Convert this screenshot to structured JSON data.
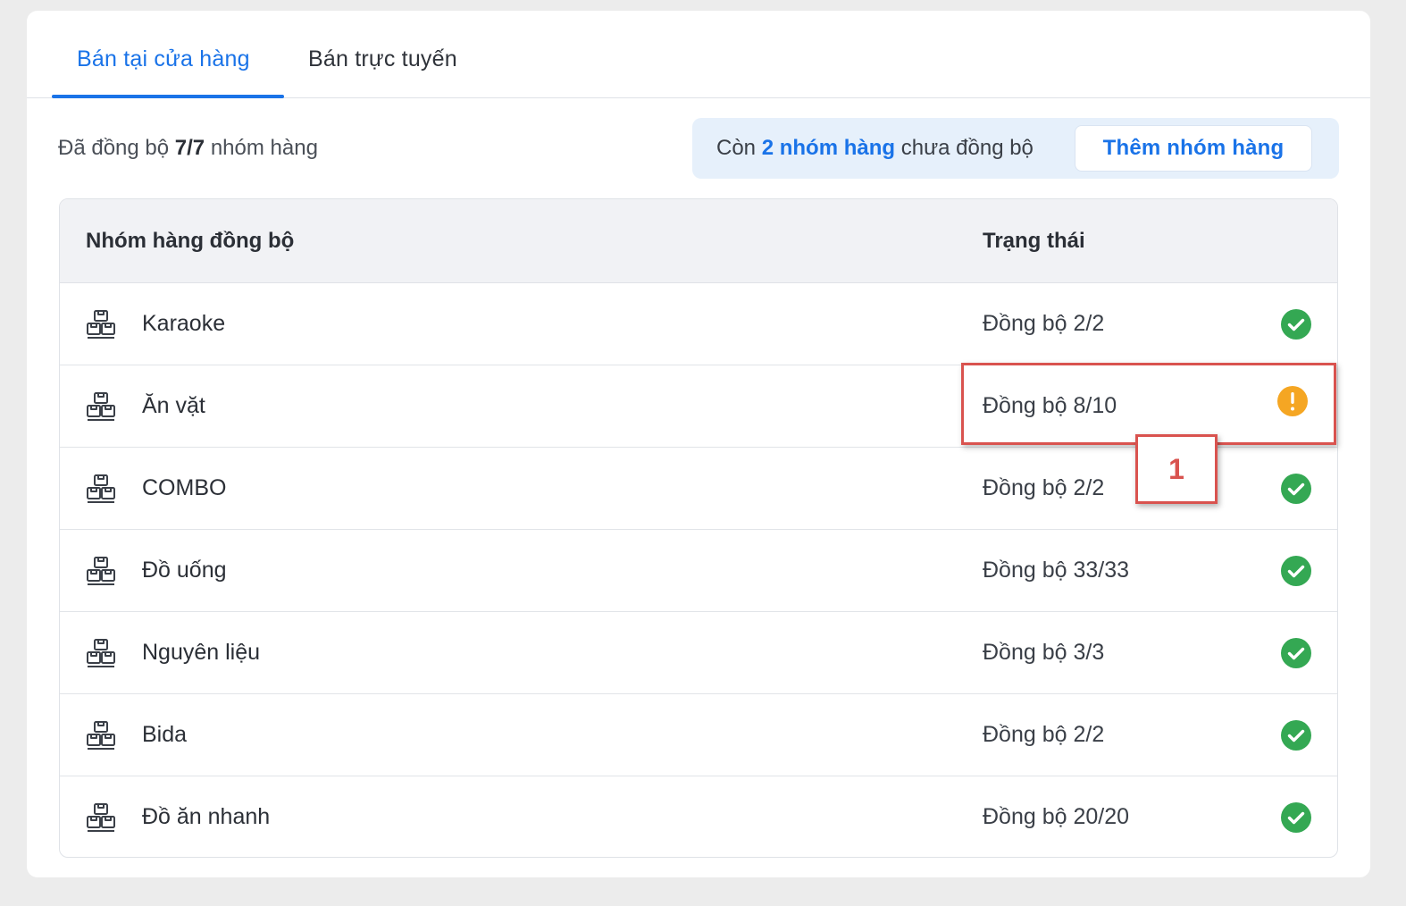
{
  "tabs": [
    {
      "label": "Bán tại cửa hàng",
      "active": true
    },
    {
      "label": "Bán trực tuyến",
      "active": false
    }
  ],
  "summary": {
    "prefix": "Đã đồng bộ ",
    "count": "7/7",
    "suffix": " nhóm hàng"
  },
  "banner": {
    "prefix": "Còn ",
    "highlight": "2 nhóm hàng",
    "suffix": " chưa đồng bộ",
    "button_label": "Thêm nhóm hàng"
  },
  "table": {
    "headers": [
      "Nhóm hàng đồng bộ",
      "Trạng thái"
    ],
    "rows": [
      {
        "name": "Karaoke",
        "status": "Đồng bộ 2/2",
        "state": "ok"
      },
      {
        "name": "Ăn vặt",
        "status": "Đồng bộ 8/10",
        "state": "warning"
      },
      {
        "name": "COMBO",
        "status": "Đồng bộ 2/2",
        "state": "ok"
      },
      {
        "name": "Đồ uống",
        "status": "Đồng bộ 33/33",
        "state": "ok"
      },
      {
        "name": "Nguyên liệu",
        "status": "Đồng bộ 3/3",
        "state": "ok"
      },
      {
        "name": "Bida",
        "status": "Đồng bộ 2/2",
        "state": "ok"
      },
      {
        "name": "Đồ ăn nhanh",
        "status": "Đồng bộ 20/20",
        "state": "ok"
      }
    ]
  },
  "annotation": {
    "label": "1"
  },
  "colors": {
    "accent": "#1a73e8",
    "ok": "#34a853",
    "warning": "#f5a623",
    "annotation": "#d9534f"
  },
  "icons": {
    "row_icon": "boxes-icon",
    "ok_icon": "check-circle-icon",
    "warning_icon": "exclamation-circle-icon"
  }
}
